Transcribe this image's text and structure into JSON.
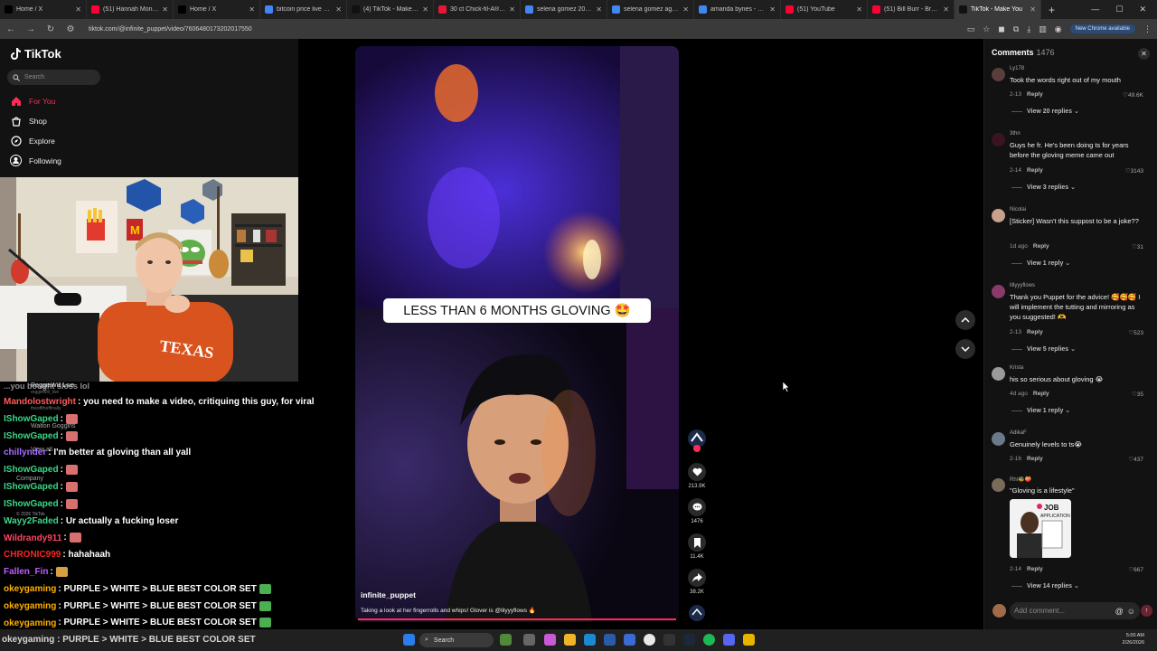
{
  "browser": {
    "tabs": [
      {
        "label": "Home / X",
        "color": "#000000"
      },
      {
        "label": "(51) Hannah Montana",
        "color": "#ff0033"
      },
      {
        "label": "Home / X",
        "color": "#000000"
      },
      {
        "label": "bitcoin price live usd",
        "color": "#4285f4"
      },
      {
        "label": "(4) TikTok - Make Your",
        "color": "#111111"
      },
      {
        "label": "30 ct Chick-fil-A® Nug",
        "color": "#e51636"
      },
      {
        "label": "selena gomez 2026 - G",
        "color": "#4285f4"
      },
      {
        "label": "selena gomez age - Go",
        "color": "#4285f4"
      },
      {
        "label": "amanda bynes - Goog",
        "color": "#4285f4"
      },
      {
        "label": "(51) YouTube",
        "color": "#ff0033"
      },
      {
        "label": "(51) Bill Burr - Breakin",
        "color": "#ff0033"
      },
      {
        "label": "TikTok - Make You",
        "color": "#111111",
        "active": true
      }
    ],
    "new_tab": "+",
    "url": "tiktok.com/@infinite_puppet/video/7606480173202017550",
    "chrome_pill": "New Chrome available"
  },
  "tiktok_nav": {
    "logo": "TikTok",
    "search_placeholder": "Search",
    "items": [
      {
        "label": "For You",
        "icon": "home-icon"
      },
      {
        "label": "Shop",
        "icon": "shop-icon"
      },
      {
        "label": "Explore",
        "icon": "compass-icon"
      },
      {
        "label": "Following",
        "icon": "following-icon"
      }
    ]
  },
  "video": {
    "caption_banner": "LESS THAN 6 MONTHS GLOVING 🤩",
    "author": "infinite_puppet",
    "description": "Taking a look at her fingerrolls and whips! Glover is @lilyyyflows 🔥",
    "actions": {
      "likes": "213.9K",
      "comments": "1476",
      "saves": "11.4K",
      "shares": "38.2K"
    }
  },
  "stream_chat": {
    "lines": [
      {
        "user": "Mandolostwright",
        "color": "#ff5a5a",
        "text": ": you need to make a video, critiquing this guy, for viral",
        "emote": false
      },
      {
        "user": "IShowGaped",
        "color": "#3cd688",
        "text": ":",
        "emote": true
      },
      {
        "user": "IShowGaped",
        "color": "#3cd688",
        "text": ":",
        "emote": true
      },
      {
        "user": "chillynder",
        "color": "#a970ff",
        "text": ": I'm better at gloving than all yall",
        "emote": false
      },
      {
        "user": "IShowGaped",
        "color": "#3cd688",
        "text": ":",
        "emote": true
      },
      {
        "user": "IShowGaped",
        "color": "#3cd688",
        "text": ":",
        "emote": true
      },
      {
        "user": "IShowGaped",
        "color": "#3cd688",
        "text": ":",
        "emote": true
      },
      {
        "user": "Wayy2Faded",
        "color": "#3cd688",
        "text": ": Ur actually a fucking loser",
        "emote": false
      },
      {
        "user": "Wildrandy911",
        "color": "#ff4466",
        "text": ":",
        "emote": true
      },
      {
        "user": "CHRONIC999",
        "color": "#ff2222",
        "text": ": hahahaah",
        "emote": false
      },
      {
        "user": "Fallen_Fin",
        "color": "#c25bff",
        "text": ":",
        "emote": true
      },
      {
        "user": "okeygaming",
        "color": "#ffb000",
        "text": ": PURPLE > WHITE > BLUE BEST COLOR SET",
        "emote": true
      },
      {
        "user": "okeygaming",
        "color": "#ffb000",
        "text": ": PURPLE > WHITE > BLUE BEST COLOR SET",
        "emote": true
      },
      {
        "user": "okeygaming",
        "color": "#ffb000",
        "text": ": PURPLE > WHITE > BLUE BEST COLOR SET",
        "emote": true
      }
    ],
    "ticker": "okeygaming : PURPLE > WHITE > BLUE BEST COLOR SET",
    "ghost": {
      "top_line": "...you bought sloss lol",
      "reggie_name": "ReggieWill Live",
      "reggie_handle": "reggiewill_live",
      "famous": "famousdailyofficial",
      "famous_sub": "theofftheffinally",
      "walton": "Walton Goggins",
      "view_all": "View all",
      "company": "Company",
      "copyright": "© 2026 TikTok"
    }
  },
  "comments": {
    "title": "Comments",
    "count": "1476",
    "items": [
      {
        "user": "Ly178",
        "text": "Took the words right out of my mouth",
        "date": "2-13",
        "likes": "49.6K",
        "view": "View 20 replies",
        "avatar": "#5a3d3d"
      },
      {
        "user": "3thn",
        "text": "Guys he fr. He's been doing ts for years before the gloving meme came out",
        "date": "2-14",
        "likes": "3143",
        "view": "View 3 replies",
        "avatar": "#3a1420"
      },
      {
        "user": "Nicolai",
        "text": "[Sticker] Wasn't this suppost to be a joke??",
        "date": "1d ago",
        "likes": "31",
        "view": "View 1 reply",
        "avatar": "#c9a08c"
      },
      {
        "user": "lillyyyflows",
        "text": "Thank you Puppet for the advice! 🥰🥰🥰 I will implement the tutting and mirroring as you suggested! 🫶",
        "date": "2-13",
        "likes": "523",
        "view": "View 5 replies",
        "avatar": "#8a3a6a"
      },
      {
        "user": "Krista",
        "text": "his so serious about gloving 😭",
        "date": "4d ago",
        "likes": "35",
        "view": "View 1 reply",
        "avatar": "#9a9a9a"
      },
      {
        "user": "AdikaF",
        "text": "Genuinely levels to ts😭",
        "date": "2-16",
        "likes": "437",
        "view": "",
        "avatar": "#6b7a8a"
      },
      {
        "user": "Rhi🐝🍑",
        "text": "\"Gloving is a lifestyle\"",
        "date": "2-14",
        "likes": "667",
        "view": "View 14 replies",
        "avatar": "#7a6a5a"
      }
    ],
    "reply_label": "Reply",
    "input_placeholder": "Add comment...",
    "sticker_image_text": "JOB APPLICATION"
  },
  "taskbar": {
    "search": "Search",
    "time": "5:00 AM",
    "date": "2/26/2026"
  }
}
